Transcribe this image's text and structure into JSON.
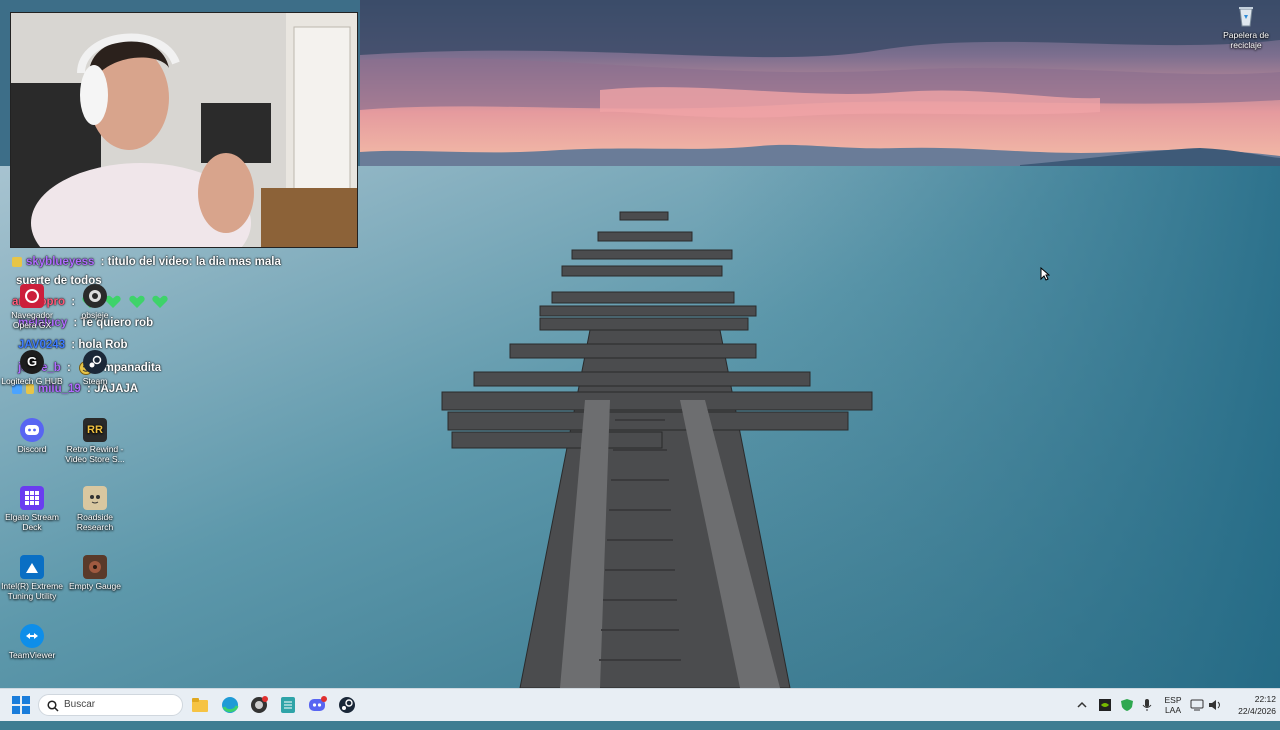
{
  "webcam": {
    "label": "streamer webcam overlay"
  },
  "chat": {
    "messages": [
      {
        "user": "skyblueyess",
        "sep": " : ",
        "text": "titulo del video: la dia mas mala",
        "cont": "suerte de todos",
        "user_color": "#b06cff",
        "badge_color": "#e8c547"
      },
      {
        "user": "antidopro",
        "sep": " : ",
        "text": "",
        "user_color": "#ff5a7a",
        "badge_color": "",
        "emotes": [
          "heart-emote",
          "heart-emote",
          "heart-emote",
          "heart-emote"
        ]
      },
      {
        "user": "melalucy",
        "sep": " : ",
        "text": "Te quiero rob",
        "user_color": "#b06cff",
        "badge_color": ""
      },
      {
        "user": "JAV0243",
        "sep": " : ",
        "text": "hola Rob",
        "user_color": "#3d7cff",
        "badge_color": ""
      },
      {
        "user": "josse_b",
        "sep": " : ",
        "text": "empanadita",
        "user_color": "#b06cff",
        "badge_color": "",
        "emotes": [
          "smile-emote"
        ]
      },
      {
        "user": "milu_19",
        "sep": " : ",
        "text": "JAJAJA",
        "user_color": "#b06cff",
        "badge_color": "#4aa3ff"
      }
    ]
  },
  "desktop": {
    "icons": [
      {
        "label": "Navegador Opera GX",
        "icon": "opera-gx-icon",
        "color": "#cc1f3b"
      },
      {
        "label": "obsjeje",
        "icon": "obs-icon",
        "color": "#2a2a2a"
      },
      {
        "label": "Logitech G HUB",
        "icon": "logitech-g-icon",
        "color": "#1d1d1d"
      },
      {
        "label": "Steam",
        "icon": "steam-icon",
        "color": "#1b2838"
      },
      {
        "label": "Discord",
        "icon": "discord-icon",
        "color": "#5865f2"
      },
      {
        "label": "Retro Rewind - Video Store S...",
        "icon": "retro-rewind-icon",
        "color": "#2a2a2a"
      },
      {
        "label": "Elgato Stream Deck",
        "icon": "stream-deck-icon",
        "color": "#6a3df0"
      },
      {
        "label": "Roadside Research",
        "icon": "roadside-research-icon",
        "color": "#d9c7a0"
      },
      {
        "label": "Intel(R) Extreme Tuning Utility",
        "icon": "intel-xtu-icon",
        "color": "#0a6fc4"
      },
      {
        "label": "Empty Gauge",
        "icon": "empty-gauge-icon",
        "color": "#5a3a2a"
      },
      {
        "label": "TeamViewer",
        "icon": "teamviewer-icon",
        "color": "#0e8ee9"
      },
      {
        "label": "Papelera de reciclaje",
        "icon": "recycle-bin-icon",
        "color": "#dfe7ef"
      }
    ]
  },
  "taskbar": {
    "search_placeholder": "Buscar",
    "apps": [
      {
        "name": "file-explorer-icon",
        "color": "#f6c343"
      },
      {
        "name": "edge-icon",
        "color": "#1f9bd6"
      },
      {
        "name": "obs-taskbar-icon",
        "color": "#333333"
      },
      {
        "name": "notepad-icon",
        "color": "#2fa4a8"
      },
      {
        "name": "discord-taskbar-icon",
        "color": "#5865f2"
      },
      {
        "name": "steam-taskbar-icon",
        "color": "#1b2838"
      }
    ],
    "lang_top": "ESP",
    "lang_bottom": "LAA",
    "time": "22:12",
    "date": "22/4/2026"
  }
}
